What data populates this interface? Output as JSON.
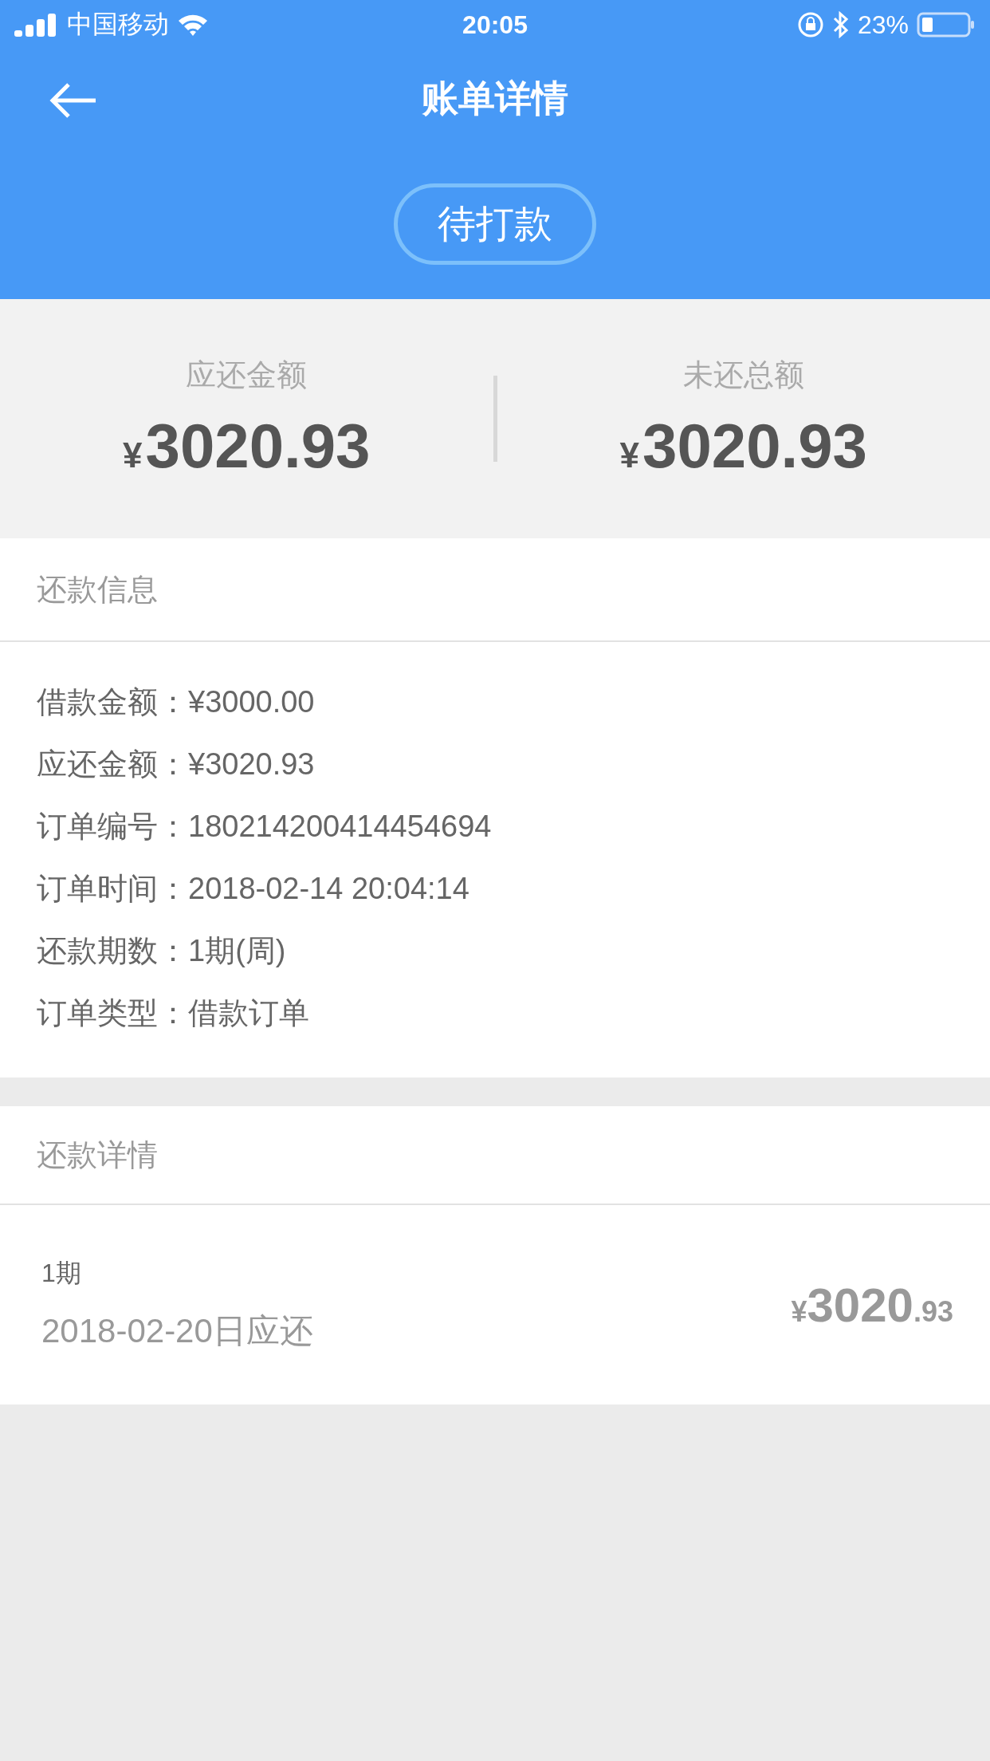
{
  "status_bar": {
    "carrier": "中国移动",
    "time": "20:05",
    "battery": "23%"
  },
  "nav": {
    "title": "账单详情"
  },
  "status_badge": "待打款",
  "summary": [
    {
      "label": "应还金额",
      "currency": "¥",
      "value": "3020.93"
    },
    {
      "label": "未还总额",
      "currency": "¥",
      "value": "3020.93"
    }
  ],
  "repayment_info": {
    "title": "还款信息",
    "rows": [
      {
        "label": "借款金额：",
        "value": "¥3000.00"
      },
      {
        "label": "应还金额：",
        "value": "¥3020.93"
      },
      {
        "label": "订单编号：",
        "value": "180214200414454694"
      },
      {
        "label": "订单时间：",
        "value": "2018-02-14 20:04:14"
      },
      {
        "label": "还款期数：",
        "value": "1期(周)"
      },
      {
        "label": "订单类型：",
        "value": "借款订单"
      }
    ]
  },
  "repayment_details": {
    "title": "还款详情",
    "items": [
      {
        "period": "1期",
        "due": "2018-02-20日应还",
        "currency": "¥",
        "integer": "3020",
        "decimal": ".93"
      }
    ]
  }
}
